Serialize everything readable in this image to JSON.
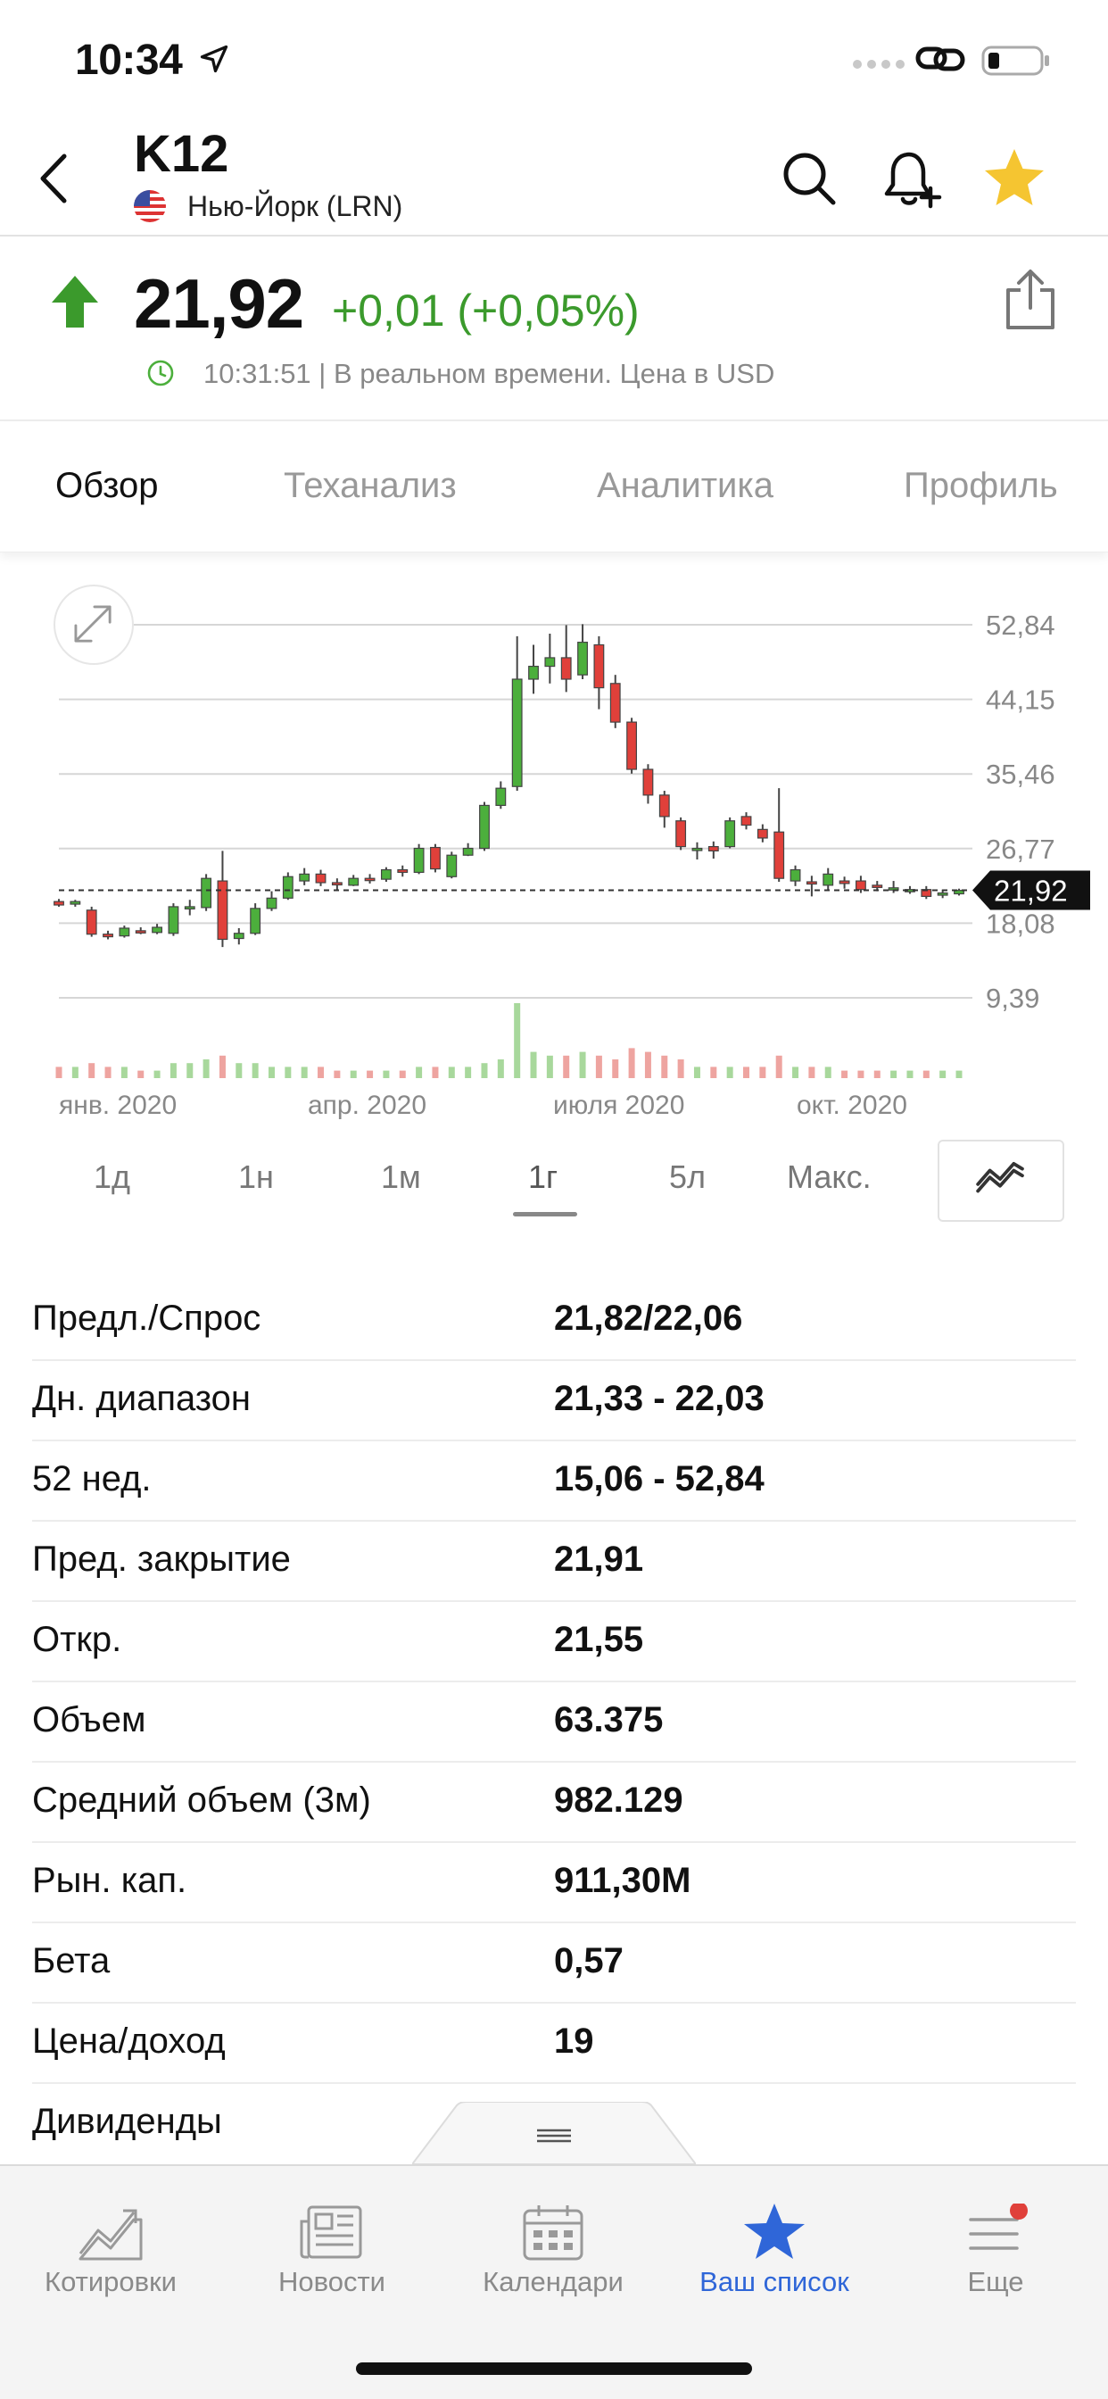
{
  "status_bar": {
    "time": "10:34"
  },
  "header": {
    "ticker": "K12",
    "exchange": "Нью-Йорк (LRN)"
  },
  "price": {
    "last": "21,92",
    "change": "+0,01 (+0,05%)",
    "realtime_text": "10:31:51 | В реальном времени. Цена в USD",
    "direction": "up",
    "up_color": "#3b9a2c"
  },
  "tabs": [
    {
      "label": "Обзор",
      "active": true
    },
    {
      "label": "Теханализ",
      "active": false
    },
    {
      "label": "Аналитика",
      "active": false
    },
    {
      "label": "Профиль",
      "active": false
    }
  ],
  "chart_data": {
    "type": "candlestick",
    "y_ticks": [
      "52,84",
      "44,15",
      "35,46",
      "26,77",
      "18,08",
      "9,39"
    ],
    "x_ticks": [
      "янв. 2020",
      "апр. 2020",
      "июля 2020",
      "окт. 2020"
    ],
    "current_price_label": "21,92",
    "current_price": 21.92,
    "ylim": [
      5.0,
      54.0
    ],
    "up_color": "#4caf3c",
    "down_color": "#e0403a",
    "candles": [
      {
        "o": 20.6,
        "c": 20.2,
        "h": 20.9,
        "l": 20.0,
        "v": 3
      },
      {
        "o": 20.3,
        "c": 20.6,
        "h": 20.8,
        "l": 20.0,
        "v": 3
      },
      {
        "o": 19.6,
        "c": 16.8,
        "h": 20.0,
        "l": 16.5,
        "v": 4
      },
      {
        "o": 16.8,
        "c": 16.5,
        "h": 17.2,
        "l": 16.2,
        "v": 3
      },
      {
        "o": 16.6,
        "c": 17.5,
        "h": 17.8,
        "l": 16.4,
        "v": 3
      },
      {
        "o": 17.2,
        "c": 17.0,
        "h": 17.6,
        "l": 16.8,
        "v": 2
      },
      {
        "o": 17.0,
        "c": 17.6,
        "h": 18.0,
        "l": 16.8,
        "v": 2
      },
      {
        "o": 16.9,
        "c": 20.0,
        "h": 20.4,
        "l": 16.6,
        "v": 4
      },
      {
        "o": 19.8,
        "c": 20.0,
        "h": 20.8,
        "l": 19.0,
        "v": 4
      },
      {
        "o": 19.9,
        "c": 23.3,
        "h": 23.8,
        "l": 19.5,
        "v": 5
      },
      {
        "o": 23.0,
        "c": 16.2,
        "h": 26.5,
        "l": 15.3,
        "v": 6
      },
      {
        "o": 16.3,
        "c": 16.9,
        "h": 17.5,
        "l": 15.6,
        "v": 4
      },
      {
        "o": 16.9,
        "c": 19.8,
        "h": 20.4,
        "l": 16.7,
        "v": 4
      },
      {
        "o": 19.8,
        "c": 21.0,
        "h": 21.8,
        "l": 19.5,
        "v": 3
      },
      {
        "o": 21.0,
        "c": 23.5,
        "h": 24.0,
        "l": 20.8,
        "v": 3
      },
      {
        "o": 23.0,
        "c": 23.8,
        "h": 24.5,
        "l": 22.5,
        "v": 3
      },
      {
        "o": 23.8,
        "c": 22.8,
        "h": 24.3,
        "l": 22.4,
        "v": 3
      },
      {
        "o": 22.8,
        "c": 22.6,
        "h": 23.3,
        "l": 21.9,
        "v": 2
      },
      {
        "o": 22.5,
        "c": 23.3,
        "h": 23.7,
        "l": 22.4,
        "v": 2
      },
      {
        "o": 23.3,
        "c": 23.1,
        "h": 23.8,
        "l": 22.7,
        "v": 2
      },
      {
        "o": 23.2,
        "c": 24.3,
        "h": 24.6,
        "l": 22.9,
        "v": 2
      },
      {
        "o": 24.3,
        "c": 24.0,
        "h": 24.8,
        "l": 23.5,
        "v": 2
      },
      {
        "o": 24.0,
        "c": 26.8,
        "h": 27.3,
        "l": 23.8,
        "v": 3
      },
      {
        "o": 26.9,
        "c": 24.4,
        "h": 27.3,
        "l": 24.0,
        "v": 3
      },
      {
        "o": 23.5,
        "c": 26.0,
        "h": 26.4,
        "l": 23.3,
        "v": 3
      },
      {
        "o": 26.0,
        "c": 26.8,
        "h": 27.4,
        "l": 25.9,
        "v": 3
      },
      {
        "o": 26.8,
        "c": 31.8,
        "h": 32.2,
        "l": 26.5,
        "v": 4
      },
      {
        "o": 31.8,
        "c": 33.8,
        "h": 34.6,
        "l": 31.4,
        "v": 5
      },
      {
        "o": 34.0,
        "c": 46.5,
        "h": 51.5,
        "l": 33.5,
        "v": 20
      },
      {
        "o": 46.5,
        "c": 48.0,
        "h": 50.5,
        "l": 44.8,
        "v": 7
      },
      {
        "o": 48.0,
        "c": 49.0,
        "h": 51.8,
        "l": 46.0,
        "v": 6
      },
      {
        "o": 49.0,
        "c": 46.5,
        "h": 52.8,
        "l": 45.0,
        "v": 6
      },
      {
        "o": 47.0,
        "c": 50.8,
        "h": 52.9,
        "l": 46.5,
        "v": 7
      },
      {
        "o": 50.5,
        "c": 45.5,
        "h": 51.5,
        "l": 43.0,
        "v": 6
      },
      {
        "o": 46.0,
        "c": 41.5,
        "h": 47.0,
        "l": 40.8,
        "v": 5
      },
      {
        "o": 41.5,
        "c": 36.0,
        "h": 42.0,
        "l": 35.5,
        "v": 8
      },
      {
        "o": 36.0,
        "c": 33.0,
        "h": 36.6,
        "l": 32.0,
        "v": 7
      },
      {
        "o": 33.0,
        "c": 30.5,
        "h": 33.5,
        "l": 29.2,
        "v": 6
      },
      {
        "o": 30.0,
        "c": 27.0,
        "h": 30.4,
        "l": 26.6,
        "v": 5
      },
      {
        "o": 26.8,
        "c": 26.8,
        "h": 27.5,
        "l": 25.5,
        "v": 3
      },
      {
        "o": 27.0,
        "c": 26.5,
        "h": 27.6,
        "l": 25.6,
        "v": 3
      },
      {
        "o": 27.0,
        "c": 30.0,
        "h": 30.4,
        "l": 26.8,
        "v": 3
      },
      {
        "o": 30.5,
        "c": 29.5,
        "h": 31.0,
        "l": 29.0,
        "v": 3
      },
      {
        "o": 29.0,
        "c": 28.0,
        "h": 29.6,
        "l": 27.5,
        "v": 3
      },
      {
        "o": 28.7,
        "c": 23.3,
        "h": 33.8,
        "l": 22.9,
        "v": 6
      },
      {
        "o": 23.0,
        "c": 24.3,
        "h": 24.8,
        "l": 22.4,
        "v": 3
      },
      {
        "o": 22.9,
        "c": 22.8,
        "h": 23.6,
        "l": 21.2,
        "v": 3
      },
      {
        "o": 22.5,
        "c": 23.8,
        "h": 24.5,
        "l": 22.0,
        "v": 3
      },
      {
        "o": 23.0,
        "c": 22.7,
        "h": 23.5,
        "l": 22.1,
        "v": 2
      },
      {
        "o": 23.0,
        "c": 22.0,
        "h": 23.6,
        "l": 21.6,
        "v": 2
      },
      {
        "o": 22.5,
        "c": 22.4,
        "h": 23.0,
        "l": 21.8,
        "v": 2
      },
      {
        "o": 22.0,
        "c": 22.2,
        "h": 23.0,
        "l": 21.6,
        "v": 2
      },
      {
        "o": 22.0,
        "c": 22.0,
        "h": 22.4,
        "l": 21.5,
        "v": 2
      },
      {
        "o": 22.0,
        "c": 21.2,
        "h": 22.4,
        "l": 20.9,
        "v": 2
      },
      {
        "o": 21.6,
        "c": 21.6,
        "h": 22.0,
        "l": 21.0,
        "v": 2
      },
      {
        "o": 21.5,
        "c": 21.9,
        "h": 22.1,
        "l": 21.3,
        "v": 2
      }
    ]
  },
  "ranges": [
    {
      "label": "1д",
      "active": false
    },
    {
      "label": "1н",
      "active": false
    },
    {
      "label": "1м",
      "active": false
    },
    {
      "label": "1г",
      "active": true
    },
    {
      "label": "5л",
      "active": false
    },
    {
      "label": "Макс.",
      "active": false
    }
  ],
  "stats": [
    {
      "label": "Предл./Спрос",
      "value": "21,82/22,06"
    },
    {
      "label": "Дн. диапазон",
      "value": "21,33 - 22,03"
    },
    {
      "label": "52 нед.",
      "value": "15,06 - 52,84"
    },
    {
      "label": "Пред. закрытие",
      "value": "21,91"
    },
    {
      "label": "Откр.",
      "value": "21,55"
    },
    {
      "label": "Объем",
      "value": "63.375"
    },
    {
      "label": "Средний объем (3м)",
      "value": "982.129"
    },
    {
      "label": "Рын. кап.",
      "value": "911,30M"
    },
    {
      "label": "Бета",
      "value": "0,57"
    },
    {
      "label": "Цена/доход",
      "value": "19"
    },
    {
      "label": "Дивиденды",
      "value": ""
    }
  ],
  "tabbar": [
    {
      "label": "Котировки",
      "icon": "quotes-chart-icon",
      "active": false
    },
    {
      "label": "Новости",
      "icon": "newspaper-icon",
      "active": false
    },
    {
      "label": "Календари",
      "icon": "calendar-icon",
      "active": false
    },
    {
      "label": "Ваш список",
      "icon": "star-icon",
      "active": true
    },
    {
      "label": "Еще",
      "icon": "menu-icon",
      "active": false,
      "badge": true
    }
  ],
  "colors": {
    "accent_blue": "#2f66d8",
    "star_yellow": "#f5c531",
    "badge_red": "#e0403a"
  }
}
